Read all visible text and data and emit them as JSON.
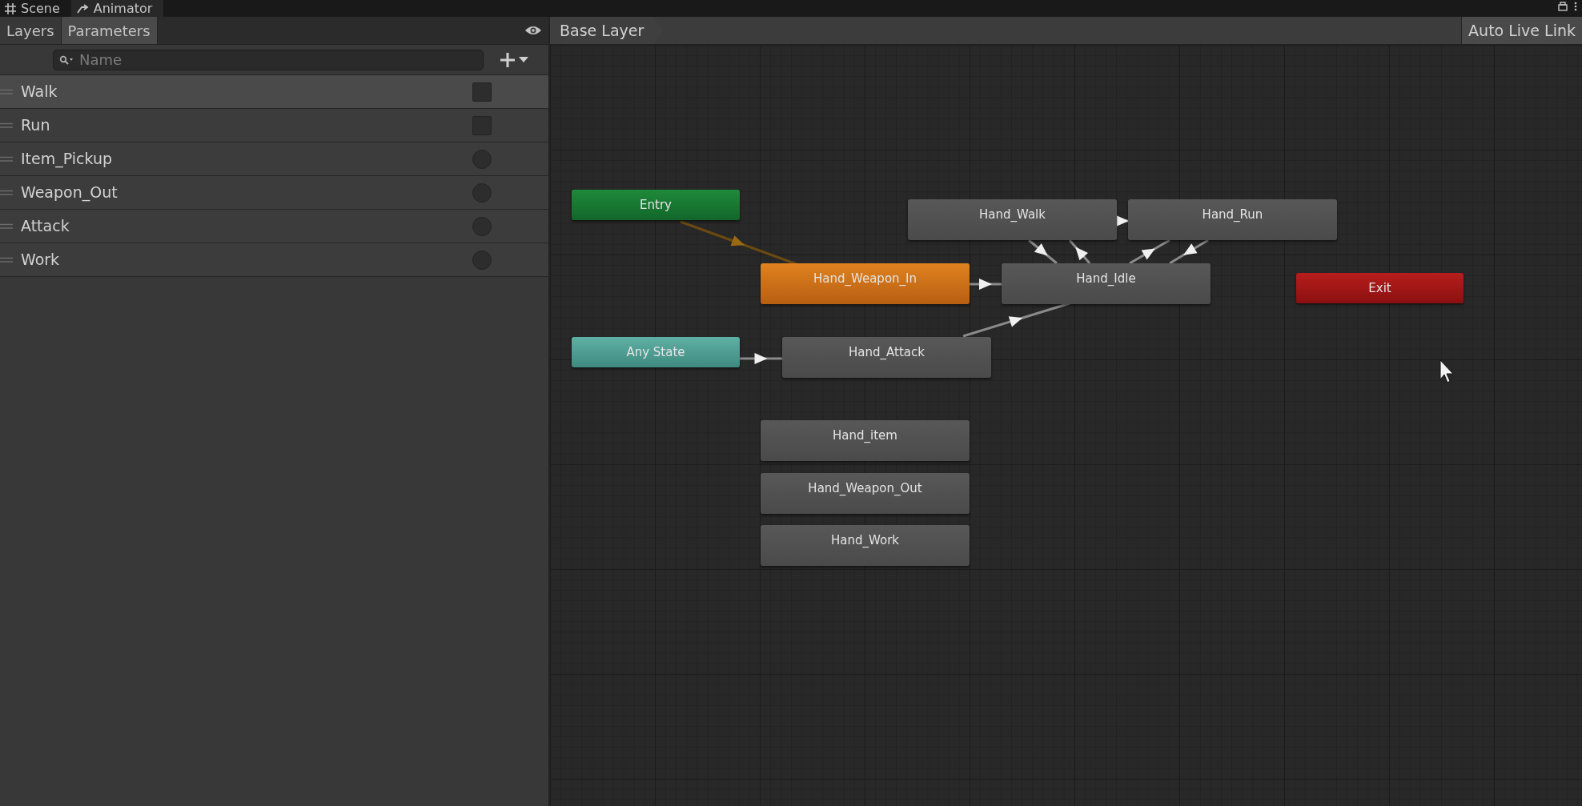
{
  "window_tabs": [
    {
      "label": "Scene",
      "selected": false
    },
    {
      "label": "Animator",
      "selected": true
    }
  ],
  "panel_tabs": [
    {
      "label": "Layers",
      "selected": false
    },
    {
      "label": "Parameters",
      "selected": true
    }
  ],
  "search": {
    "placeholder": "Name"
  },
  "parameters": [
    {
      "name": "Walk",
      "kind": "bool",
      "checked": false,
      "selected": true
    },
    {
      "name": "Run",
      "kind": "bool",
      "checked": false,
      "selected": false
    },
    {
      "name": "Item_Pickup",
      "kind": "trigger",
      "checked": false,
      "selected": false
    },
    {
      "name": "Weapon_Out",
      "kind": "trigger",
      "checked": false,
      "selected": false
    },
    {
      "name": "Attack",
      "kind": "trigger",
      "checked": false,
      "selected": false
    },
    {
      "name": "Work",
      "kind": "trigger",
      "checked": false,
      "selected": false
    }
  ],
  "breadcrumb": "Base Layer",
  "auto_live_link": "Auto Live Link",
  "states": [
    {
      "name": "Entry",
      "kind": "entry"
    },
    {
      "name": "Hand_Walk",
      "kind": "state"
    },
    {
      "name": "Hand_Run",
      "kind": "state"
    },
    {
      "name": "Hand_Weapon_In",
      "kind": "default"
    },
    {
      "name": "Hand_Idle",
      "kind": "state"
    },
    {
      "name": "Exit",
      "kind": "exit"
    },
    {
      "name": "Any State",
      "kind": "any"
    },
    {
      "name": "Hand_Attack",
      "kind": "state"
    },
    {
      "name": "Hand_item",
      "kind": "state"
    },
    {
      "name": "Hand_Weapon_Out",
      "kind": "state"
    },
    {
      "name": "Hand_Work",
      "kind": "state"
    }
  ]
}
